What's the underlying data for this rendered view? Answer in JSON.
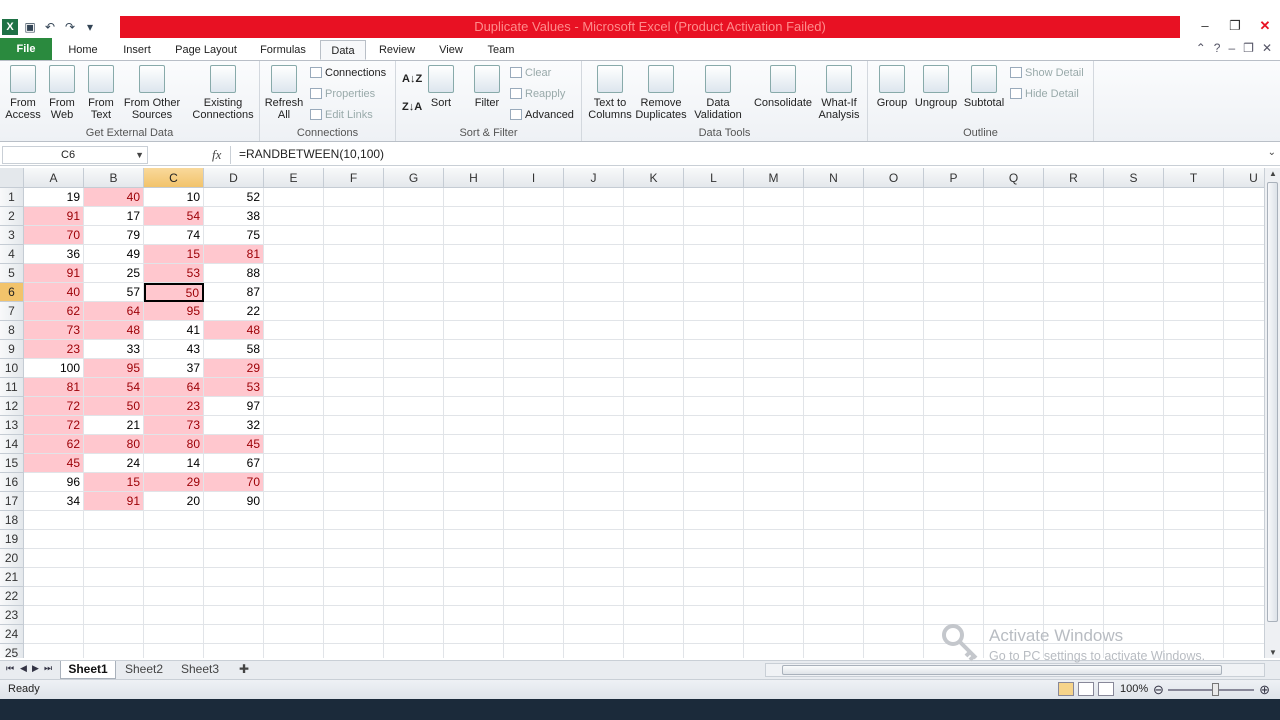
{
  "window": {
    "title": "Duplicate Values - Microsoft Excel (Product Activation Failed)",
    "controls": [
      "–",
      "❐",
      "✕"
    ]
  },
  "quick_access": {
    "undo": "↶",
    "redo": "↷",
    "customize": "▾"
  },
  "tabs": [
    "File",
    "Home",
    "Insert",
    "Page Layout",
    "Formulas",
    "Data",
    "Review",
    "View",
    "Team"
  ],
  "active_tab": "Data",
  "ribbon": {
    "get_external_data": {
      "label": "Get External Data",
      "from_access": "From Access",
      "from_web": "From Web",
      "from_text": "From Text",
      "from_other": "From Other Sources",
      "existing": "Existing Connections"
    },
    "connections": {
      "label": "Connections",
      "refresh": "Refresh All",
      "connections": "Connections",
      "properties": "Properties",
      "edit_links": "Edit Links"
    },
    "sort_filter": {
      "label": "Sort & Filter",
      "sort": "Sort",
      "filter": "Filter",
      "clear": "Clear",
      "reapply": "Reapply",
      "advanced": "Advanced"
    },
    "data_tools": {
      "label": "Data Tools",
      "text_to_columns": "Text to Columns",
      "remove_duplicates": "Remove Duplicates",
      "data_validation": "Data Validation",
      "consolidate": "Consolidate",
      "what_if": "What-If Analysis"
    },
    "outline": {
      "label": "Outline",
      "group": "Group",
      "ungroup": "Ungroup",
      "subtotal": "Subtotal",
      "show_detail": "Show Detail",
      "hide_detail": "Hide Detail"
    }
  },
  "formula_bar": {
    "name_box": "C6",
    "fx": "fx",
    "formula": "=RANDBETWEEN(10,100)"
  },
  "columns": [
    "A",
    "B",
    "C",
    "D",
    "E",
    "F",
    "G",
    "H",
    "I",
    "J",
    "K",
    "L",
    "M",
    "N",
    "O",
    "P",
    "Q",
    "R",
    "S",
    "T",
    "U"
  ],
  "selected_column": "C",
  "selected_row": 6,
  "active_cell": "C6",
  "row_count": 25,
  "data": [
    [
      19,
      40,
      10,
      52
    ],
    [
      91,
      17,
      54,
      38
    ],
    [
      70,
      79,
      74,
      75
    ],
    [
      36,
      49,
      15,
      81
    ],
    [
      91,
      25,
      53,
      88
    ],
    [
      40,
      57,
      50,
      87
    ],
    [
      62,
      64,
      95,
      22
    ],
    [
      73,
      48,
      41,
      48
    ],
    [
      23,
      33,
      43,
      58
    ],
    [
      100,
      95,
      37,
      29
    ],
    [
      81,
      54,
      64,
      53
    ],
    [
      72,
      50,
      23,
      97
    ],
    [
      72,
      21,
      73,
      32
    ],
    [
      62,
      80,
      80,
      45
    ],
    [
      45,
      24,
      14,
      67
    ],
    [
      96,
      15,
      29,
      70
    ],
    [
      34,
      91,
      20,
      90
    ]
  ],
  "duplicate_fill": "#ffc7ce",
  "duplicate_text": "#9c0006",
  "sheet_tabs": [
    "Sheet1",
    "Sheet2",
    "Sheet3"
  ],
  "active_sheet": "Sheet1",
  "status": {
    "ready": "Ready",
    "zoom": "100%"
  },
  "watermark": {
    "line1": "Activate Windows",
    "line2": "Go to PC settings to activate Windows."
  }
}
